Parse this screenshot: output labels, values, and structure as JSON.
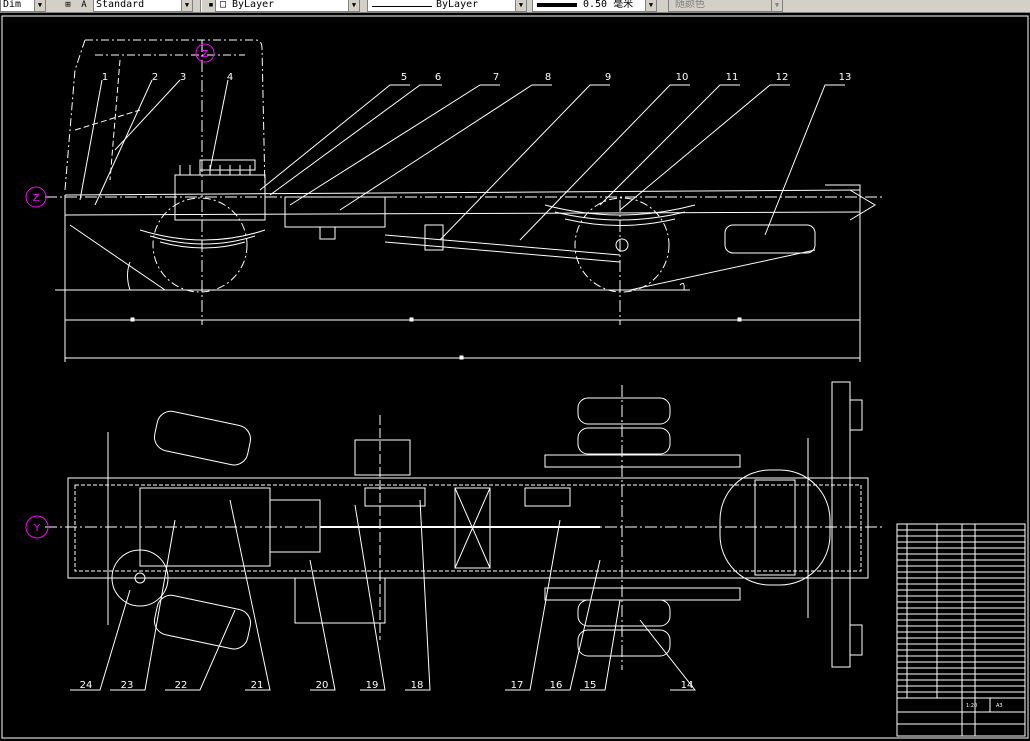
{
  "toolbar": {
    "dimstyle": "Dim",
    "textstyle": "Standard",
    "layer": "ByLayer",
    "linetype": "ByLayer",
    "lineweight": "0.50 毫米",
    "plotstyle": "随颜色"
  },
  "colors": {
    "background": "#000000",
    "lines": "#ffffff",
    "axis_bubble": "#ff00ff"
  },
  "axis_bubbles": [
    "Z",
    "Z",
    "Y"
  ],
  "callouts": {
    "top": [
      "1",
      "2",
      "3",
      "4",
      "5",
      "6",
      "7",
      "8",
      "9",
      "10",
      "11",
      "12",
      "13"
    ],
    "bottom": [
      "24",
      "23",
      "22",
      "21",
      "20",
      "19",
      "18",
      "17",
      "16",
      "15",
      "14"
    ]
  },
  "title_block": {
    "scale": "1:20",
    "sheet": "A3"
  }
}
